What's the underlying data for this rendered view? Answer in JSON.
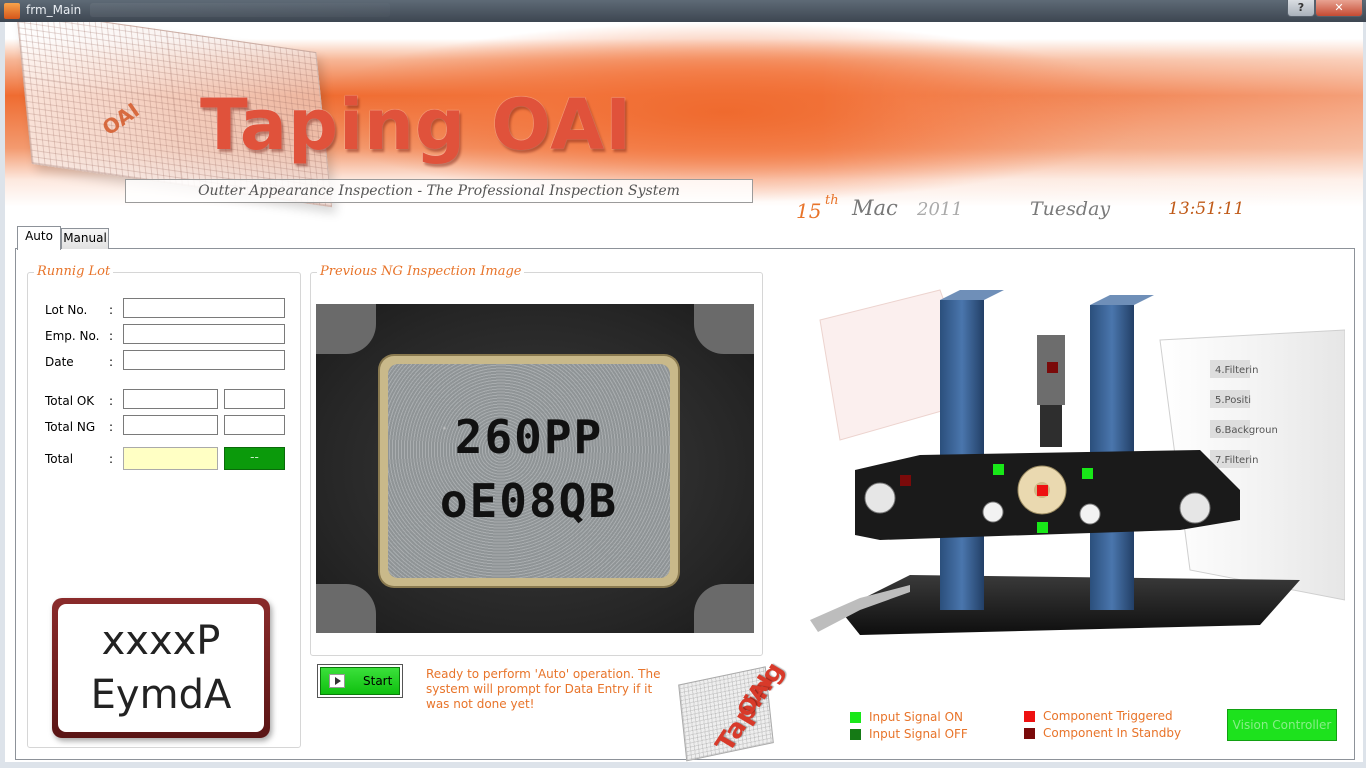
{
  "window": {
    "title": "frm_Main"
  },
  "header": {
    "title": "Taping OAI",
    "subtitle": "Outter Appearance Inspection - The Professional Inspection System",
    "glass_logo": "OAI",
    "date": {
      "day": "15",
      "suffix": "th",
      "month": "Mac",
      "year": "2011",
      "weekday": "Tuesday",
      "time": "13:51:11"
    }
  },
  "tabs": [
    {
      "label": "Auto",
      "active": true
    },
    {
      "label": "Manual",
      "active": false
    }
  ],
  "running_lot": {
    "title": "Runnig Lot",
    "fields": [
      {
        "label": "Lot No.",
        "value": ""
      },
      {
        "label": "Emp. No.",
        "value": ""
      },
      {
        "label": "Date",
        "value": ""
      }
    ],
    "totals": [
      {
        "label": "Total OK",
        "value": "",
        "extra": ""
      },
      {
        "label": "Total NG",
        "value": "",
        "extra": ""
      },
      {
        "label": "Total",
        "value": "",
        "extra": "--"
      }
    ],
    "colon": ":"
  },
  "logo": {
    "line1": "xxxxP",
    "line2": "EymdA"
  },
  "ng_panel": {
    "title": "Previous NG Inspection Image",
    "image_text": [
      "260PP",
      "oE08QB"
    ]
  },
  "start_button": {
    "label": "Start"
  },
  "status_message": "Ready to perform 'Auto' operation. The system will prompt for Data Entry if it was not done yet!",
  "small_logo": {
    "text1": "Taping",
    "text2": "OAI"
  },
  "legend": [
    {
      "label": "Input Signal ON",
      "color": "#18e818"
    },
    {
      "label": "Input Signal OFF",
      "color": "#157a15"
    },
    {
      "label": "Component Triggered",
      "color": "#ee1111"
    },
    {
      "label": "Component In Standby",
      "color": "#7a0a0a"
    }
  ],
  "vision_controller": {
    "label": "Vision Controller",
    "color": "#1de21d"
  },
  "machine": {
    "signals": [
      {
        "name": "camera",
        "state": "standby"
      },
      {
        "name": "left-sensor",
        "state": "standby"
      },
      {
        "name": "top-left-sensor",
        "state": "on"
      },
      {
        "name": "top-right-sensor",
        "state": "on"
      },
      {
        "name": "center-component",
        "state": "triggered"
      },
      {
        "name": "bottom-sensor",
        "state": "on"
      }
    ],
    "screen_text": [
      "4.Filterin",
      "5.Positi",
      "6.Backgroun",
      "7.Filterin"
    ]
  }
}
